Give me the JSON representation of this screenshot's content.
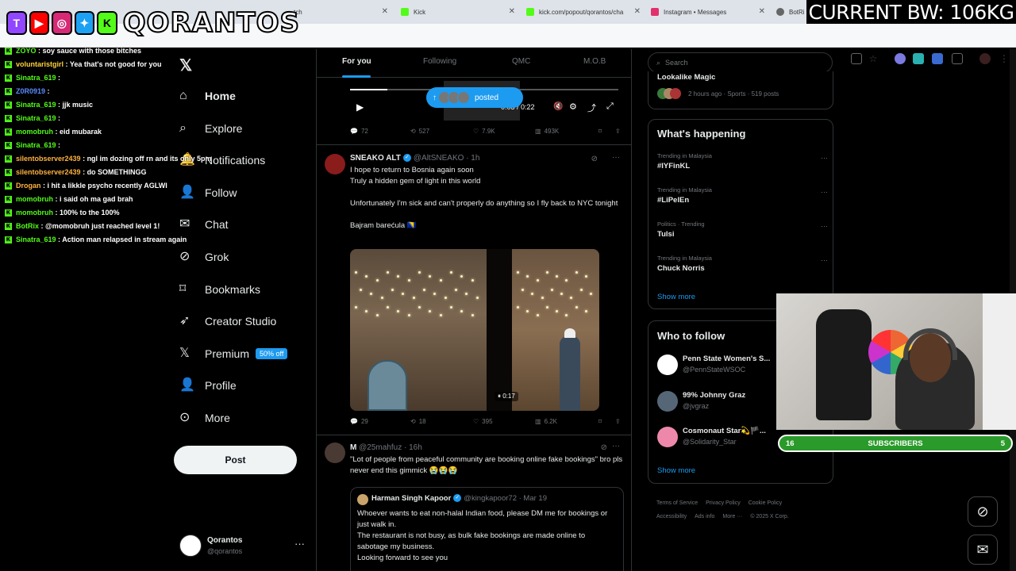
{
  "browser": {
    "tabs": [
      {
        "label": "tch",
        "color": "#9146ff"
      },
      {
        "label": "Kick",
        "color": "#53fc18"
      },
      {
        "label": "kick.com/popout/qorantos/cha",
        "color": "#53fc18"
      },
      {
        "label": "Instagram • Messages",
        "color": "#e1306c"
      },
      {
        "label": "BotRi",
        "color": "#666666"
      }
    ]
  },
  "overlay": {
    "stream_name": "QORANTOS",
    "bw_text": "CURRENT BW: 106KG",
    "chat": [
      {
        "user": "ZOYO",
        "color": "#53fc18",
        "msg": "soy sauce with those bitches"
      },
      {
        "user": "voluntaristgirl",
        "color": "#ffd33d",
        "msg": "Yea that's not good for you"
      },
      {
        "user": "Sinatra_619",
        "color": "#53fc18",
        "msg": ""
      },
      {
        "user": "Z0R0919",
        "color": "#5b8cff",
        "msg": ""
      },
      {
        "user": "Sinatra_619",
        "color": "#53fc18",
        "msg": "jjk music"
      },
      {
        "user": "Sinatra_619",
        "color": "#53fc18",
        "msg": ""
      },
      {
        "user": "momobruh",
        "color": "#53fc18",
        "msg": "eid mubarak"
      },
      {
        "user": "Sinatra_619",
        "color": "#53fc18",
        "msg": ""
      },
      {
        "user": "silentobserver2439",
        "color": "#ffb23d",
        "msg": "ngl im dozing off rn and its only 5pm"
      },
      {
        "user": "silentobserver2439",
        "color": "#ffb23d",
        "msg": "do SOMETHINGG"
      },
      {
        "user": "Drogan",
        "color": "#ffb23d",
        "msg": "i hit a likkle psycho recently AGLWI"
      },
      {
        "user": "momobruh",
        "color": "#53fc18",
        "msg": "i said oh ma gad brah"
      },
      {
        "user": "momobruh",
        "color": "#53fc18",
        "msg": "100% to the 100%"
      },
      {
        "user": "BotRix",
        "color": "#53fc18",
        "msg": "@momobruh just reached level 1!"
      },
      {
        "user": "Sinatra_619",
        "color": "#53fc18",
        "msg": "Action man relapsed in stream again"
      }
    ],
    "subscribers": {
      "left": "16",
      "label": "SUBSCRIBERS",
      "right": "5"
    }
  },
  "nav": {
    "items": [
      {
        "label": "Home",
        "icon": "home-icon"
      },
      {
        "label": "Explore",
        "icon": "search-icon"
      },
      {
        "label": "Notifications",
        "icon": "bell-icon"
      },
      {
        "label": "Follow",
        "icon": "add-user-icon"
      },
      {
        "label": "Chat",
        "icon": "mail-icon"
      },
      {
        "label": "Grok",
        "icon": "grok-icon"
      },
      {
        "label": "Bookmarks",
        "icon": "bookmark-icon"
      },
      {
        "label": "Creator Studio",
        "icon": "rocket-icon"
      },
      {
        "label": "Premium",
        "icon": "x-icon"
      },
      {
        "label": "Profile",
        "icon": "person-icon"
      },
      {
        "label": "More",
        "icon": "more-icon"
      }
    ],
    "premium_badge": "50% off",
    "post_label": "Post",
    "me": {
      "name": "Qorantos",
      "handle": "@qorantos"
    }
  },
  "timeline": {
    "tabs": [
      "For you",
      "Following",
      "QMC",
      "M.O.B"
    ],
    "video_time": "0:03 / 0:22",
    "posted_label": "posted",
    "first_actions": {
      "replies": "72",
      "reposts": "527",
      "likes": "7.9K",
      "views": "493K"
    },
    "tweet1": {
      "name": "SNEAKO ALT",
      "handle": "@AltSNEAKO",
      "time": "· 1h",
      "lines": [
        "I hope to return to Bosnia again soon",
        "Truly a hidden gem of light in this world",
        "",
        "Unfortunately I'm sick and can't properly do anything so I fly back to NYC tonight",
        "",
        "Bajram barećula 🇧🇦"
      ],
      "video_timer": "0:17",
      "actions": {
        "replies": "29",
        "reposts": "18",
        "likes": "395",
        "views": "6.2K"
      }
    },
    "tweet2": {
      "name": "M",
      "handle": "@25mahfuz",
      "time": "· 16h",
      "text": "\"Lot of people from peaceful community are booking online fake bookings\" bro pls never end this gimmick 😭😭😭",
      "quote": {
        "name": "Harman Singh Kapoor",
        "handle": "@kingkapoor72",
        "time": "· Mar 19",
        "lines": [
          "Whoever wants to eat non-halal Indian food, please DM me for bookings or just walk in.",
          "The restaurant is not busy, as bulk fake bookings are made online to sabotage my business.",
          "Looking forward to see you"
        ]
      }
    }
  },
  "right": {
    "search_placeholder": "Search",
    "top_snippet": {
      "title": "Lookalike Magic",
      "meta": "2 hours ago · Sports · 519 posts"
    },
    "happening_title": "What's happening",
    "trends": [
      {
        "ctx": "Trending in Malaysia",
        "title": "#IYFinKL"
      },
      {
        "ctx": "Trending in Malaysia",
        "title": "#LiPelEn"
      },
      {
        "ctx": "Politics · Trending",
        "title": "Tulsi"
      },
      {
        "ctx": "Trending in Malaysia",
        "title": "Chuck Norris"
      }
    ],
    "show_more": "Show more",
    "wtf_title": "Who to follow",
    "wtf": [
      {
        "name": "Penn State Women's S...",
        "handle": "@PennStateWSOC",
        "color": "#ffffff"
      },
      {
        "name": "99% Johnny Graz",
        "handle": "@jvgraz",
        "color": "#556677"
      },
      {
        "name": "Cosmonaut Star💫🏴...",
        "handle": "@Solidarity_Star",
        "color": "#ee88aa"
      }
    ],
    "footer": [
      "Terms of Service",
      "Privacy Policy",
      "Cookie Policy",
      "Accessibility",
      "Ads info",
      "More ···",
      "© 2025 X Corp."
    ]
  }
}
